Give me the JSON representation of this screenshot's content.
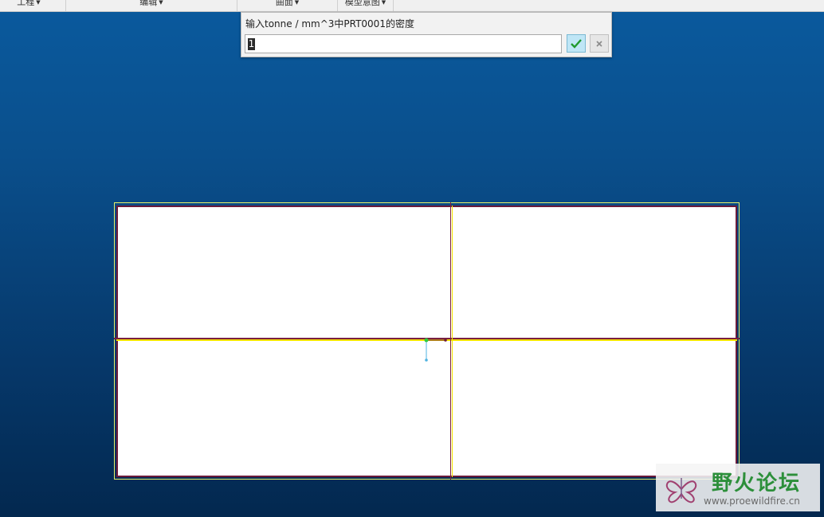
{
  "ribbon": {
    "groups": [
      {
        "label": "工程"
      },
      {
        "label": "编辑"
      },
      {
        "label": "曲面"
      },
      {
        "label": "模型意图"
      }
    ]
  },
  "density_dialog": {
    "prompt": "输入tonne / mm^3中PRT0001的密度",
    "value": "1",
    "ok_icon": "checkmark-icon",
    "cancel_icon": "close-icon"
  },
  "watermark": {
    "title": "野火论坛",
    "url": "www.proewildfire.cn"
  },
  "colors": {
    "background_top": "#0a5a9e",
    "background_bottom": "#03284f",
    "sketch_outline": "#6b1a3a",
    "centerline_yellow": "#f5e400",
    "ok_green": "#1f9a2e"
  }
}
